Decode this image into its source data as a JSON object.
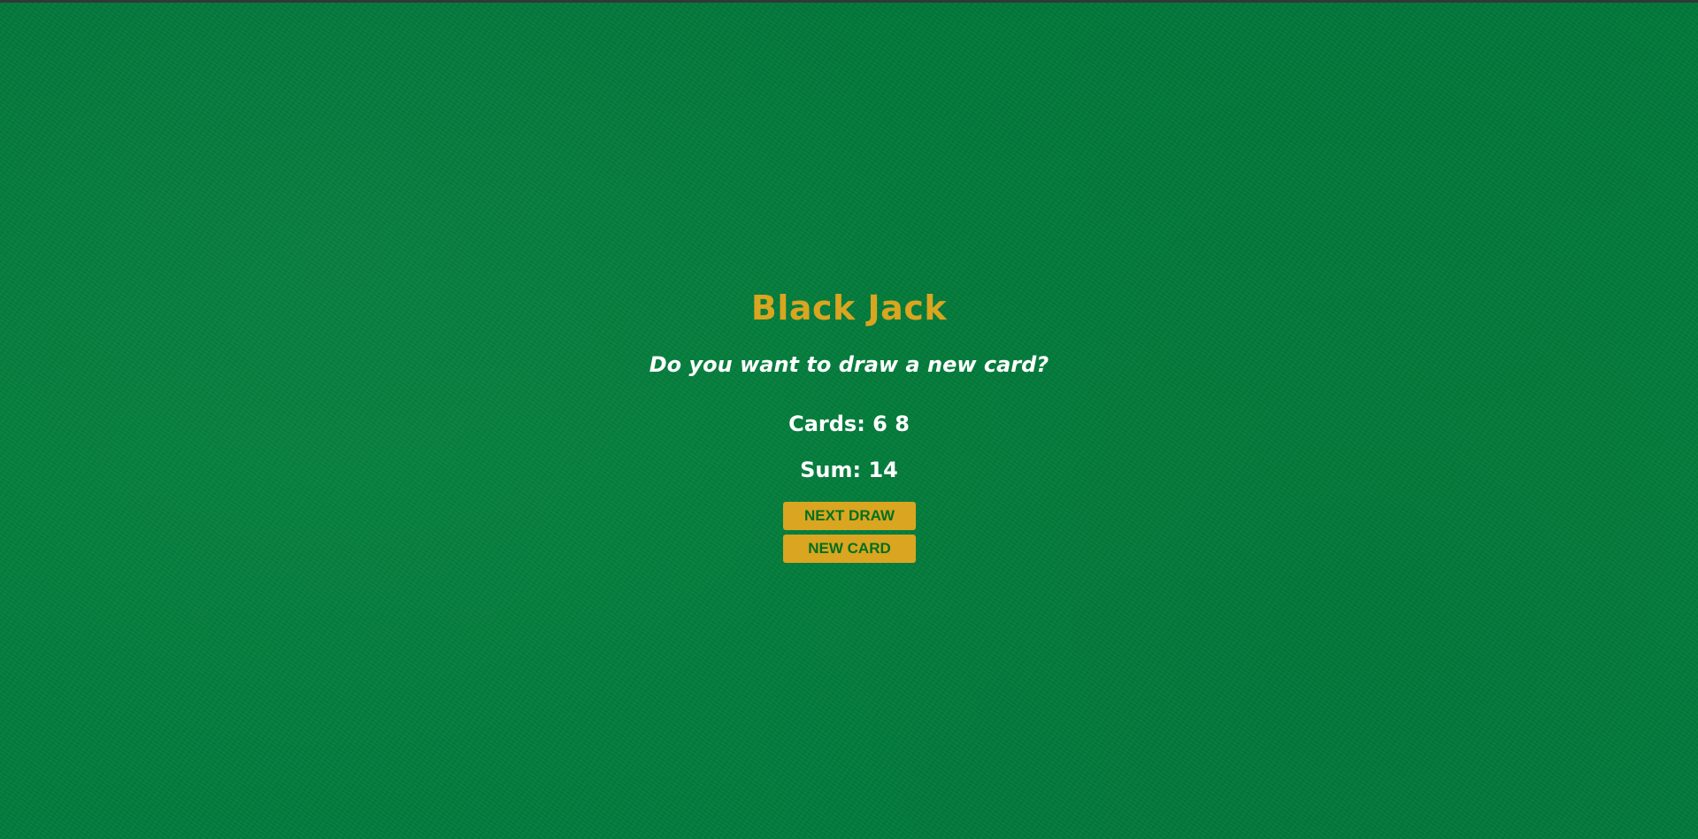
{
  "game": {
    "title": "Black Jack",
    "message": "Do you want to draw a new card?",
    "cards_text": "Cards: 6 8",
    "sum_text": "Sum: 14",
    "buttons": {
      "next_draw": "NEXT DRAW",
      "new_card": "NEW CARD"
    }
  },
  "colors": {
    "felt": "#027a38",
    "gold": "#daa520",
    "button_text": "#016f1f",
    "text": "#ffffff"
  }
}
